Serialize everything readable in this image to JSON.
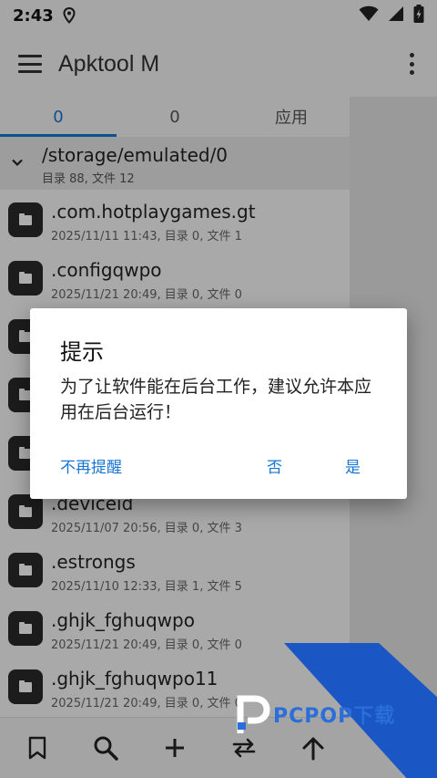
{
  "status": {
    "time": "2:43"
  },
  "app": {
    "title": "Apktool M"
  },
  "tabs": [
    {
      "label": "0"
    },
    {
      "label": "0"
    },
    {
      "label": "应用"
    }
  ],
  "path": {
    "current": "/storage/emulated/0",
    "meta": "目录 88, 文件 12"
  },
  "files": [
    {
      "name": ".com.hotplaygames.gt",
      "meta": "2025/11/11 11:43, 目录 0, 文件 1"
    },
    {
      "name": ".configqwpo",
      "meta": "2025/11/21 20:49, 目录 0, 文件 0"
    },
    {
      "name": "",
      "meta": ""
    },
    {
      "name": "",
      "meta": ""
    },
    {
      "name": "",
      "meta": ""
    },
    {
      "name": ".deviceid",
      "meta": "2025/11/07 20:56, 目录 0, 文件 3"
    },
    {
      "name": ".estrongs",
      "meta": "2025/11/10 12:33, 目录 1, 文件 5"
    },
    {
      "name": ".ghjk_fghuqwpo",
      "meta": "2025/11/21 20:49, 目录 0, 文件 0"
    },
    {
      "name": ".ghjk_fghuqwpo11",
      "meta": "2025/11/21 20:49, 目录 0, 文件 0"
    }
  ],
  "dialog": {
    "title": "提示",
    "message": "为了让软件能在后台工作，建议允许本应用在后台运行！",
    "btn_never": "不再提醒",
    "btn_no": "否",
    "btn_yes": "是"
  },
  "watermark": {
    "text": "PCPOP下载"
  },
  "colors": {
    "accent": "#1976d2",
    "watermark_blue": "#1a56c4"
  },
  "icons": {
    "status": [
      "location-icon",
      "wifi-icon",
      "signal-icon",
      "battery-charging-icon"
    ],
    "bottom": [
      "bookmark-icon",
      "search-icon",
      "add-icon",
      "swap-icon",
      "arrow-up-icon"
    ]
  }
}
